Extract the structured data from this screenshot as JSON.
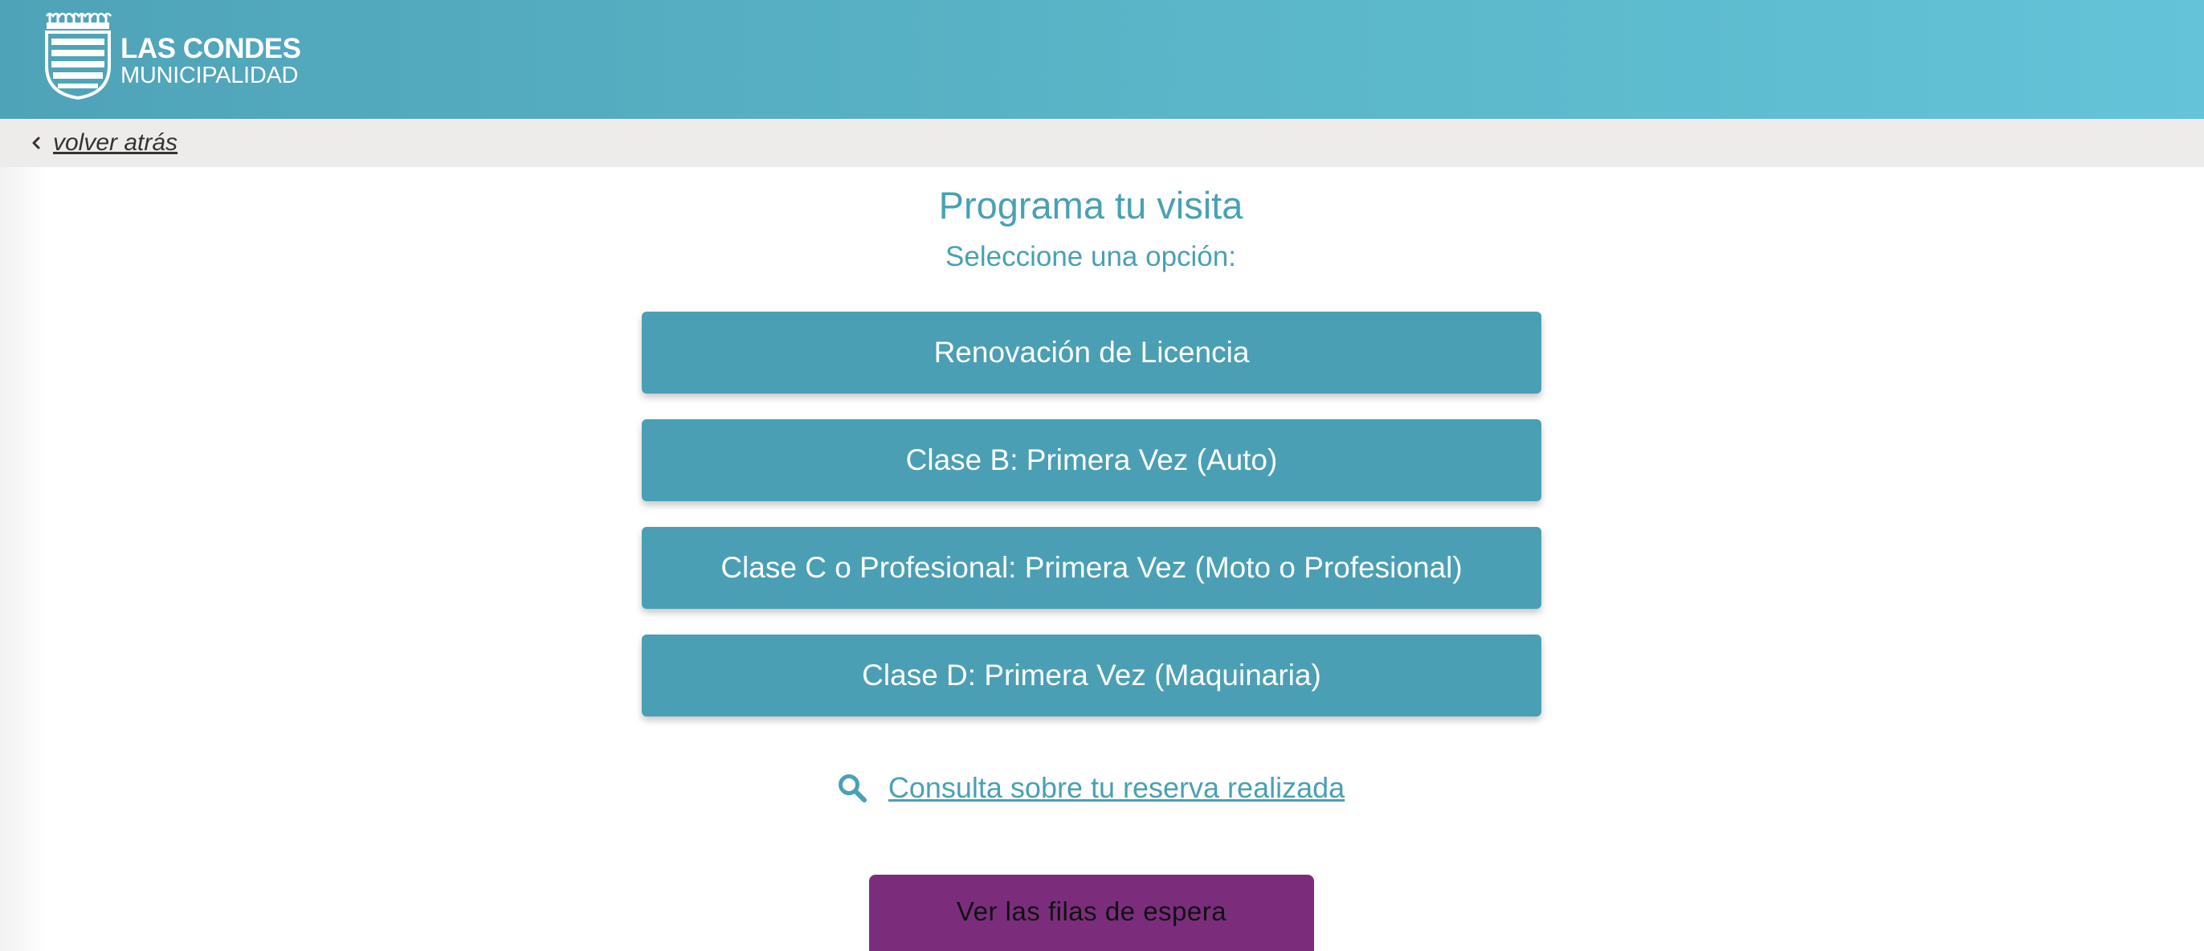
{
  "header": {
    "logo_title": "LAS CONDES",
    "logo_subtitle": "MUNICIPALIDAD"
  },
  "nav": {
    "back_label": "volver atrás"
  },
  "main": {
    "title": "Programa tu visita",
    "subtitle": "Seleccione una opción:",
    "options": [
      {
        "label": "Renovación de Licencia"
      },
      {
        "label": "Clase B: Primera Vez (Auto)"
      },
      {
        "label": "Clase C o Profesional: Primera Vez (Moto o Profesional)"
      },
      {
        "label": "Clase D: Primera Vez (Maquinaria)"
      }
    ],
    "consulta_label": "Consulta sobre tu reserva realizada",
    "queue_label": "Ver las filas de espera"
  },
  "colors": {
    "header_start": "#4fa3b8",
    "header_end": "#63c3d8",
    "accent": "#4a9fb4",
    "queue_button": "#7b2d7c",
    "back_bar": "#eeecea"
  },
  "icons": {
    "logo": "crest-shield-icon",
    "back": "chevron-left-icon",
    "consulta": "search-icon"
  }
}
